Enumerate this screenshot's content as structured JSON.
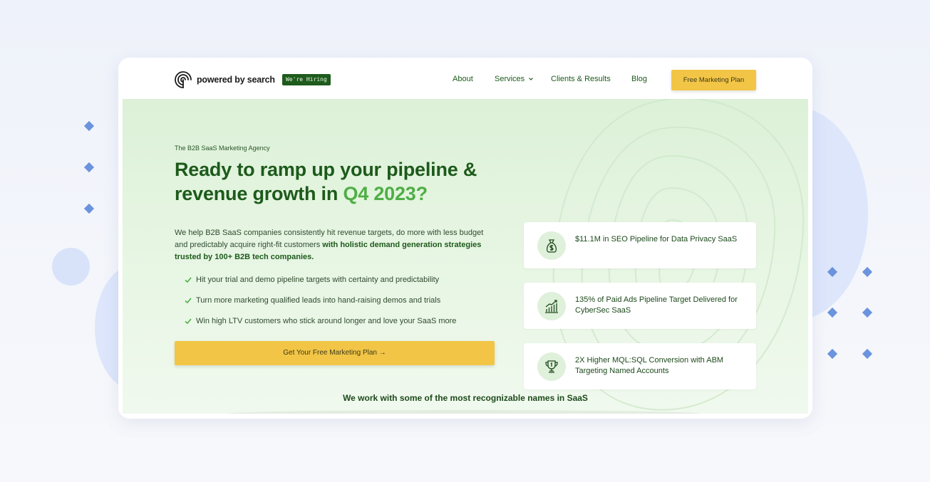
{
  "brand": {
    "name": "powered by search",
    "hiring_badge": "We're Hiring"
  },
  "nav": {
    "items": [
      {
        "label": "About"
      },
      {
        "label": "Services"
      },
      {
        "label": "Clients & Results"
      },
      {
        "label": "Blog"
      }
    ],
    "cta_label": "Free Marketing Plan"
  },
  "hero": {
    "eyebrow": "The B2B SaaS Marketing Agency",
    "headline_part1": "Ready to ramp up your pipeline & revenue growth in ",
    "headline_accent": "Q4 2023?",
    "body_plain": "We help B2B SaaS companies consistently hit revenue targets, do more with less budget and predictably acquire right-fit customers ",
    "body_bold": "with holistic demand generation strategies trusted by 100+ B2B tech companies.",
    "bullets": [
      "Hit your trial and demo pipeline targets with certainty and predictability",
      "Turn more marketing qualified leads into hand-raising demos and trials",
      "Win high LTV customers who stick around longer and love your SaaS more"
    ],
    "cta_label": "Get Your Free Marketing Plan  →"
  },
  "stats": [
    {
      "icon": "money-bag-icon",
      "text": "$11.1M in SEO Pipeline for Data Privacy SaaS"
    },
    {
      "icon": "growth-chart-icon",
      "text": "135% of Paid Ads Pipeline Target Delivered for CyberSec SaaS"
    },
    {
      "icon": "trophy-icon",
      "text": "2X Higher MQL:SQL Conversion with ABM Targeting Named Accounts"
    }
  ],
  "logos_heading": "We work with some of the most recognizable names in SaaS",
  "colors": {
    "primary_green": "#1d5a1b",
    "accent_green": "#4fae45",
    "cta_yellow": "#f2c546",
    "decor_blue": "#6b93de"
  }
}
